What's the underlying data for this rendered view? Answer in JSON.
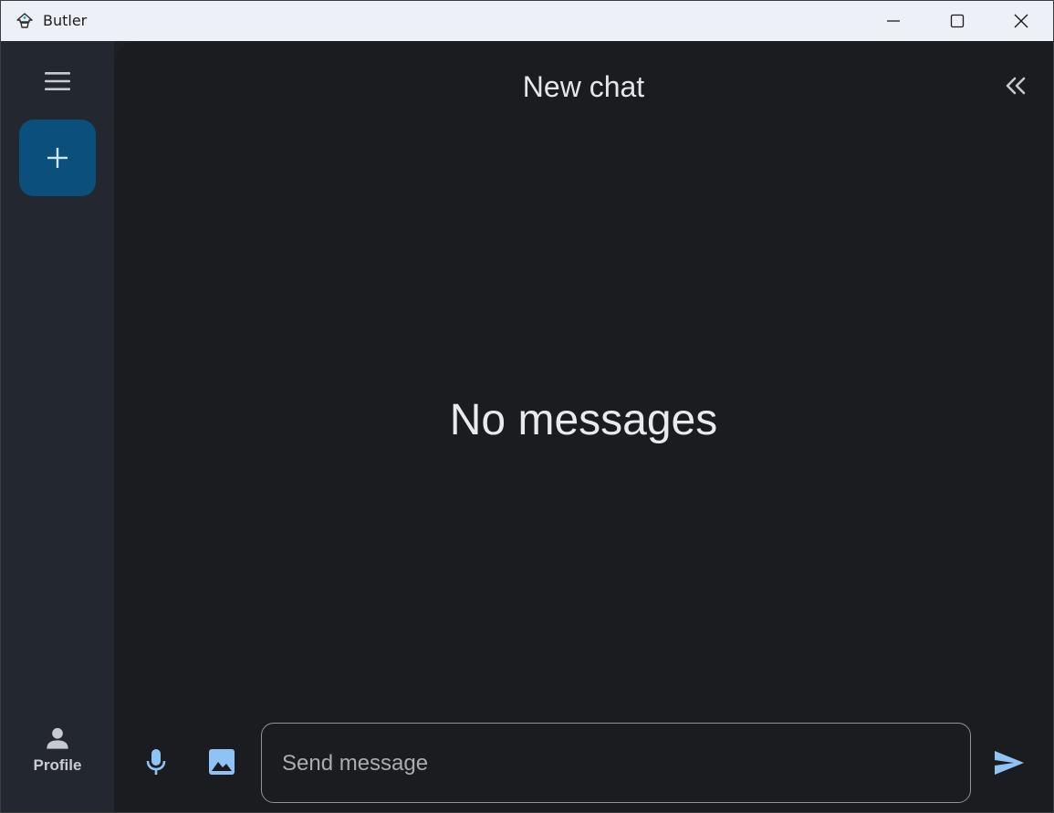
{
  "window": {
    "title": "Butler",
    "controls": {
      "minimize_icon": "minimize-icon",
      "maximize_icon": "maximize-icon",
      "close_icon": "close-icon"
    }
  },
  "nav_rail": {
    "menu_icon": "hamburger-menu-icon",
    "new_chat_icon": "plus-icon",
    "profile": {
      "icon": "person-icon",
      "label": "Profile"
    }
  },
  "main": {
    "title": "New chat",
    "collapse_icon": "double-chevron-left-icon",
    "empty_state": "No messages"
  },
  "composer": {
    "mic_icon": "microphone-icon",
    "image_icon": "image-icon",
    "placeholder": "Send message",
    "value": "",
    "send_icon": "send-icon"
  },
  "colors": {
    "accent": "#8fc3f5",
    "fab_background": "#0b4f7c",
    "rail_background": "#23272f",
    "main_background": "#1b1c1f",
    "titlebar_background": "#eef0f8"
  }
}
